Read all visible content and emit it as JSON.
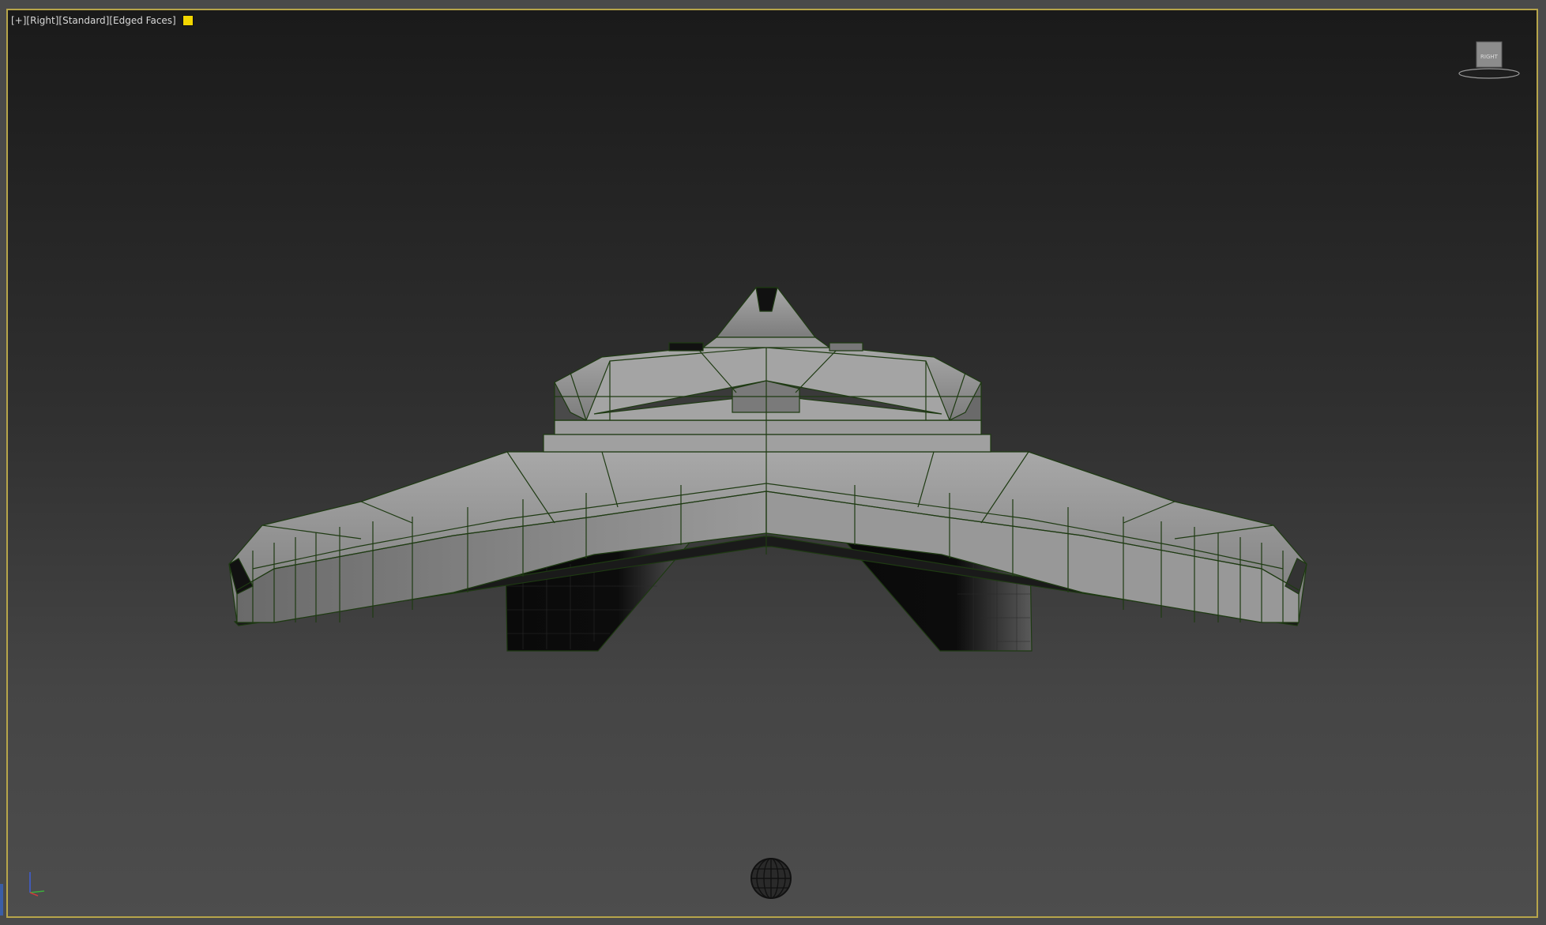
{
  "viewport": {
    "label_segments": [
      "[+]",
      "[Right]",
      "[Standard]",
      "[Edged Faces]"
    ],
    "swatch_color": "#f2d600",
    "border_color": "#b7a54a"
  },
  "viewcube": {
    "face_label": "RIGHT"
  },
  "axis_tripod": {
    "x": "",
    "y": "",
    "z": ""
  },
  "model": {
    "fill_color": "#8e8e8e",
    "edge_color": "#1e3a12"
  }
}
